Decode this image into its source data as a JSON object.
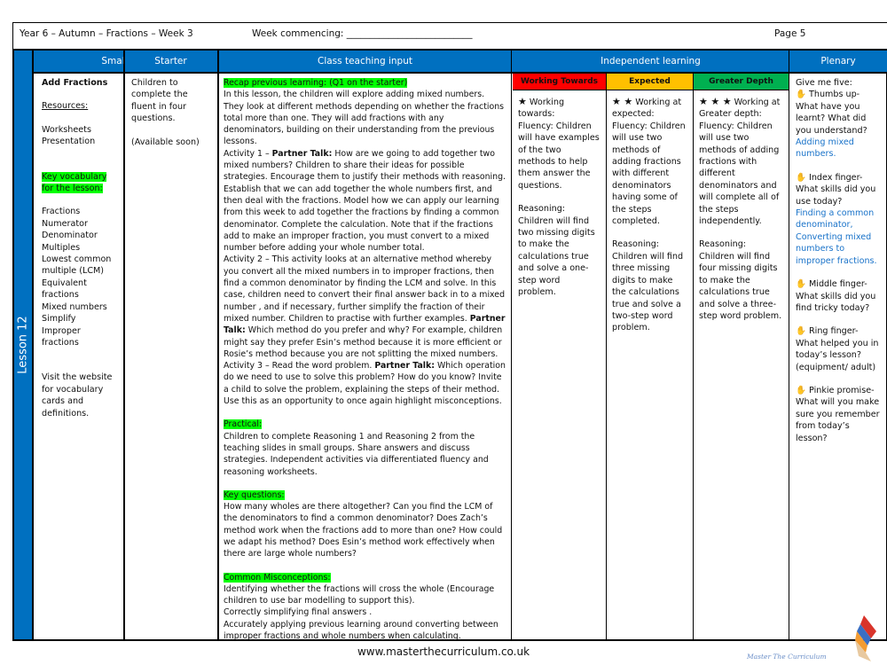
{
  "header": {
    "title": "Year 6 – Autumn – Fractions – Week 3",
    "week_commencing": "Week commencing: ___________________________",
    "page": "Page 5"
  },
  "side_label": "Lesson 12",
  "columns": {
    "small_step": "Small step",
    "starter": "Starter",
    "class_teaching": "Class teaching input",
    "independent": "Independent learning",
    "plenary": "Plenary"
  },
  "tiers": {
    "towards": {
      "label": "Working Towards",
      "color": "#ff0000"
    },
    "expected": {
      "label": "Expected",
      "color": "#ffc000"
    },
    "greater": {
      "label": "Greater Depth",
      "color": "#00b050"
    }
  },
  "small_step": {
    "title": "Add Fractions",
    "resources_label": "Resources:",
    "resources": [
      "Worksheets",
      "Presentation"
    ],
    "vocab_label": "Key vocabulary for the lesson:",
    "vocab": [
      "Fractions",
      "Numerator",
      "Denominator",
      "Multiples",
      "Lowest common multiple (LCM)",
      "Equivalent fractions",
      "Mixed numbers",
      "Simplify",
      "Improper fractions"
    ],
    "website_note": "Visit the website for vocabulary cards and definitions."
  },
  "starter": {
    "text": "Children to complete the fluent in four questions.",
    "availability": "(Available soon)"
  },
  "class_teaching": {
    "recap_label": "Recap previous learning: (Q1 on the starter)",
    "intro": "In this lesson, the children will explore adding mixed numbers. They look at different methods depending on whether the fractions total more than one. They will add fractions with any denominators, building on their understanding from the previous lessons.",
    "a1_prefix": "Activity 1 – ",
    "partner_talk": "Partner Talk:",
    "a1_text": " How are we going to add together two mixed numbers? Children to share their ideas for possible strategies. Encourage them to justify their methods with reasoning. Establish that we can add together the whole numbers first, and then deal with the fractions. Model how we can apply our learning from this week to add together the fractions by finding a common denominator. Complete the calculation. Note  that if the fractions add to make an improper fraction, you must convert  to a mixed number before adding your whole number total.",
    "a2_text": "Activity 2 – This activity looks at an alternative method whereby you convert all the mixed numbers in to improper fractions, then find a common denominator by finding the LCM and solve. In this case, children need to convert their final answer back in to a mixed number , and if necessary, further simplify the fraction of their mixed number. Children to practise with further examples.  ",
    "a2_text_b": " Which method do you prefer and why? For example, children might say they prefer Esin’s method because it is more efficient or Rosie’s method because you are not splitting the mixed numbers.",
    "a3_prefix": "Activity 3 – Read the word problem. ",
    "a3_text": " Which operation do we need to use to solve this problem? How do you know? Invite a child to solve the problem, explaining the steps of their method. Use this as an opportunity to once again highlight misconceptions.",
    "practical_label": "Practical:",
    "practical_text": "Children to complete Reasoning 1 and Reasoning 2 from the teaching slides in small groups. Share answers and discuss strategies. Independent activities via differentiated fluency and reasoning worksheets.",
    "key_questions_label": "Key questions:",
    "key_questions_text": "How many wholes are there altogether? Can you find the LCM of the denominators to find a common denominator? Does Zach’s method work when the fractions add to more than one? How could we adapt his method? Does Esin’s method work effectively when there are large whole numbers?",
    "misconceptions_label": "Common Misconceptions:",
    "misconceptions": [
      "Identifying whether the fractions will cross the whole (Encourage children to use bar modelling to support this).",
      "Correctly simplifying final answers .",
      "Accurately applying previous learning around converting between improper fractions and whole numbers when calculating."
    ]
  },
  "independent": {
    "towards": {
      "stars": "★",
      "heading": " Working towards:",
      "fluency": "Fluency: Children will have examples of the two methods to help them answer the questions.",
      "reasoning": "Reasoning: Children will find two missing digits to make the calculations true and solve a one-step word problem."
    },
    "expected": {
      "stars": "★ ★",
      "heading": " Working at expected:",
      "fluency": "Fluency: Children will use two methods of adding fractions with different denominators having some of the steps completed.",
      "reasoning": "Reasoning: Children will find three missing digits to make the calculations true and solve a two-step word problem."
    },
    "greater": {
      "stars": "★ ★ ★",
      "heading": " Working at Greater depth:",
      "fluency": "Fluency: Children will use two methods of adding fractions with different denominators and will complete all of the steps independently.",
      "reasoning": "Reasoning: Children will find four missing digits to make the calculations true and solve a three-step word problem."
    }
  },
  "plenary": {
    "intro": "Give me five:",
    "icon": "✋",
    "items": [
      {
        "prompt": " Thumbs up- What have you learnt? What did you understand?",
        "answer": "Adding mixed numbers."
      },
      {
        "prompt": " Index finger- What skills did you use today?",
        "answer": "Finding  a common denominator, Converting mixed numbers to improper fractions."
      },
      {
        "prompt": " Middle finger- What skills did you find tricky today?",
        "answer": ""
      },
      {
        "prompt": " Ring finger- What helped you in today’s lesson? (equipment/ adult)",
        "answer": ""
      },
      {
        "prompt": " Pinkie promise- What will you make sure you remember from today’s lesson?",
        "answer": ""
      }
    ]
  },
  "footer": {
    "url": "www.masterthecurriculum.co.uk",
    "logo_text": "Master The Curriculum"
  }
}
